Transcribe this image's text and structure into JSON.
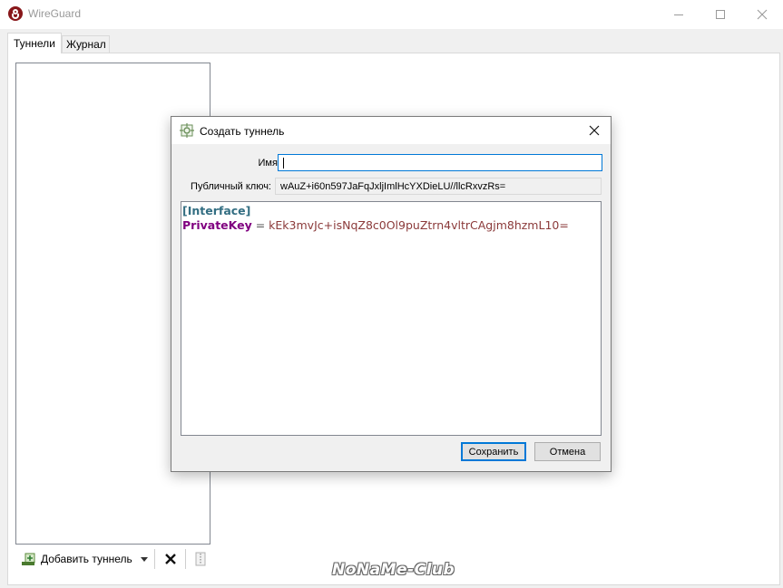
{
  "window": {
    "title": "WireGuard"
  },
  "tabs": [
    {
      "label": "Туннели",
      "active": true
    },
    {
      "label": "Журнал",
      "active": false
    }
  ],
  "toolbar": {
    "add_tunnel_label": "Добавить туннель"
  },
  "dialog": {
    "title": "Создать туннель",
    "name_label": "Имя:",
    "name_value": "",
    "pubkey_label": "Публичный ключ:",
    "pubkey_value": "wAuZ+i60n597JaFqJxljImlHcYXDieLU//llcRxvzRs=",
    "config": {
      "section": "[Interface]",
      "key": "PrivateKey",
      "equals": " = ",
      "value": "kEk3mvJc+isNqZ8c0Ol9puZtrn4vltrCAgjm8hzmL10="
    },
    "save_label": "Сохранить",
    "cancel_label": "Отмена"
  },
  "colors": {
    "accent": "#0078d7",
    "logo": "#88171a",
    "config_section": "#336e82",
    "config_key": "#800080",
    "config_value": "#8b3a3a"
  },
  "icons": [
    "wireguard-logo-icon",
    "minimize-icon",
    "maximize-icon",
    "close-icon",
    "add-tunnel-icon",
    "chevron-down-icon",
    "delete-icon",
    "export-zip-icon",
    "new-tunnel-icon"
  ],
  "watermark": "NoNaMe-Club"
}
